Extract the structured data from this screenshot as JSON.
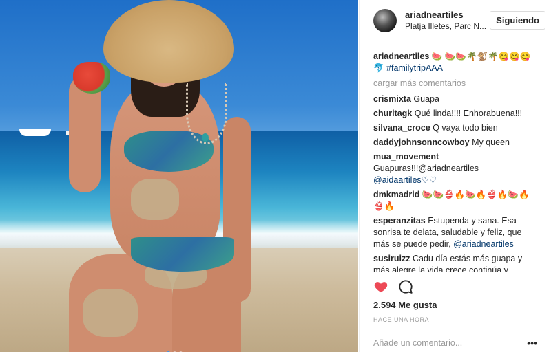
{
  "post": {
    "username": "ariadneartiles",
    "location": "Platja Illetes, Parc N...",
    "follow_label": "Siguiendo",
    "caption_emojis": "🍉 🍉🍉🌴🐒🌴😋😋😋",
    "caption_tag": "🐬 #familytripAAA",
    "load_more": "cargar más comentarios",
    "likes": "2.594 Me gusta",
    "time": "HACE UNA HORA",
    "comment_placeholder": "Añade un comentario...",
    "more_label": "•••"
  },
  "comments": [
    {
      "user": "crismixta",
      "text": "Guapa",
      "mention": ""
    },
    {
      "user": "churitagk",
      "text": "Qué linda!!!! Enhorabuena!!!",
      "mention": ""
    },
    {
      "user": "silvana_croce",
      "text": "Q vaya todo bien",
      "mention": ""
    },
    {
      "user": "daddyjohnsonncowboy",
      "text": "My queen",
      "mention": ""
    },
    {
      "user": "mua_movement",
      "text": "Guapuras!!!@ariadneartiles",
      "mention": "@aidaartiles♡♡"
    },
    {
      "user": "dmkmadrid",
      "text": "🍉🍉👙🔥🍉🔥👙🔥🍉🔥👙🔥",
      "mention": ""
    },
    {
      "user": "esperanzitas",
      "text": "Estupenda y sana. Esa sonrisa te delata, saludable y feliz, que más se puede pedir,",
      "mention": "@ariadneartiles"
    },
    {
      "user": "susiruizz",
      "text": "Cadu día estás más guapa y más alegre,la vida crece continúa y siempre te ilumina",
      "mention": ""
    }
  ],
  "colors": {
    "like_red": "#ed4956",
    "link_blue": "#003569",
    "muted": "#999999"
  },
  "icons": {
    "like": "heart-icon",
    "comment": "comment-bubble-icon",
    "options": "more-options-icon"
  }
}
